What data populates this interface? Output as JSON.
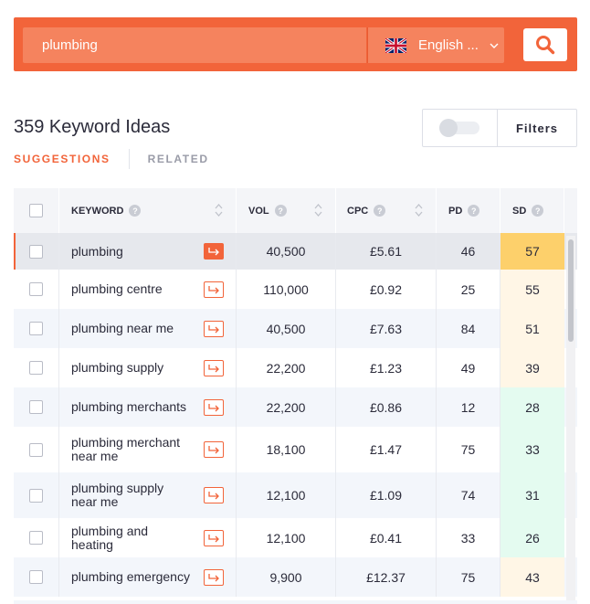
{
  "search": {
    "query": "plumbing",
    "language": "English ...",
    "flag_icon": "uk-flag-icon",
    "search_icon": "search-icon",
    "accent": "#f2643a"
  },
  "header": {
    "title": "359 Keyword Ideas",
    "filters_label": "Filters"
  },
  "tabs": [
    {
      "label": "SUGGESTIONS",
      "active": true
    },
    {
      "label": "RELATED",
      "active": false
    }
  ],
  "table": {
    "columns": [
      "KEYWORD",
      "VOL",
      "CPC",
      "PD",
      "SD"
    ],
    "rows": [
      {
        "keyword": "plumbing",
        "vol": "40,500",
        "cpc": "£5.61",
        "pd": "46",
        "sd": "57",
        "sd_color": "#fdd06b"
      },
      {
        "keyword": "plumbing centre",
        "vol": "110,000",
        "cpc": "£0.92",
        "pd": "25",
        "sd": "55",
        "sd_color": "#fff6e6"
      },
      {
        "keyword": "plumbing near me",
        "vol": "40,500",
        "cpc": "£7.63",
        "pd": "84",
        "sd": "51",
        "sd_color": "#fff6e6"
      },
      {
        "keyword": "plumbing supply",
        "vol": "22,200",
        "cpc": "£1.23",
        "pd": "49",
        "sd": "39",
        "sd_color": "#fff6e6"
      },
      {
        "keyword": "plumbing merchants",
        "vol": "22,200",
        "cpc": "£0.86",
        "pd": "12",
        "sd": "28",
        "sd_color": "#e4fbf0"
      },
      {
        "keyword": "plumbing merchant near me",
        "vol": "18,100",
        "cpc": "£1.47",
        "pd": "75",
        "sd": "33",
        "sd_color": "#e4fbf0"
      },
      {
        "keyword": "plumbing supply near me",
        "vol": "12,100",
        "cpc": "£1.09",
        "pd": "74",
        "sd": "31",
        "sd_color": "#e4fbf0"
      },
      {
        "keyword": "plumbing and heating",
        "vol": "12,100",
        "cpc": "£0.41",
        "pd": "33",
        "sd": "26",
        "sd_color": "#e4fbf0"
      },
      {
        "keyword": "plumbing emergency",
        "vol": "9,900",
        "cpc": "£12.37",
        "pd": "75",
        "sd": "43",
        "sd_color": "#fff6e6"
      }
    ]
  }
}
